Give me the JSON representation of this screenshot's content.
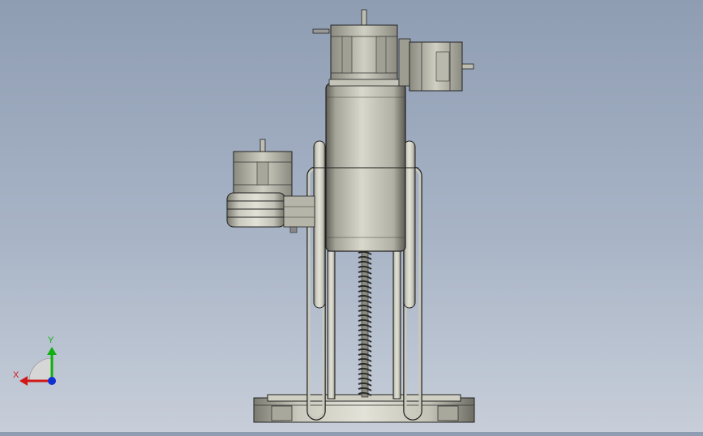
{
  "viewport": {
    "model": "robot-arm-front-view",
    "colors": {
      "background_top": "#8f9db3",
      "background_bottom": "#c7ced9",
      "metal_light": "#d9d9cf",
      "metal_mid": "#b4b4a8",
      "metal_dark": "#5a5a52",
      "edge": "#1e1e1e"
    }
  },
  "triad": {
    "x_label": "X",
    "y_label": "Y",
    "x_color": "#d01818",
    "y_color": "#10b010",
    "z_color": "#1030d0"
  }
}
